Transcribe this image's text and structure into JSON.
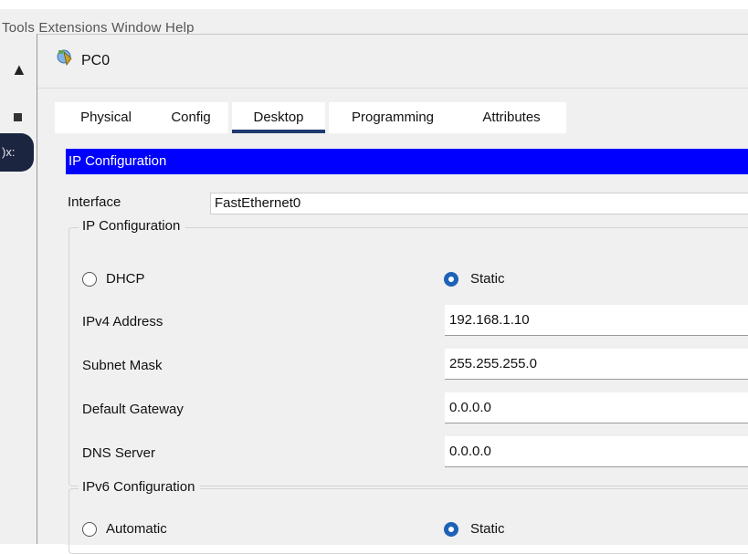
{
  "background_app": {
    "menu_text": "Tools Extensions Window Help",
    "side_text": ")x:"
  },
  "window": {
    "title": "PC0",
    "icon": "pc-app-icon"
  },
  "tabs": [
    {
      "label": "Physical",
      "active": false
    },
    {
      "label": "Config",
      "active": false
    },
    {
      "label": "Desktop",
      "active": true
    },
    {
      "label": "Programming",
      "active": false
    },
    {
      "label": "Attributes",
      "active": false
    }
  ],
  "ip_config": {
    "header": "IP Configuration",
    "interface_label": "Interface",
    "interface_value": "FastEthernet0",
    "ipv4": {
      "legend": "IP Configuration",
      "dhcp_label": "DHCP",
      "static_label": "Static",
      "mode": "Static",
      "fields": [
        {
          "label": "IPv4 Address",
          "value": "192.168.1.10"
        },
        {
          "label": "Subnet Mask",
          "value": "255.255.255.0"
        },
        {
          "label": "Default Gateway",
          "value": "0.0.0.0"
        },
        {
          "label": "DNS Server",
          "value": "0.0.0.0"
        }
      ]
    },
    "ipv6": {
      "legend": "IPv6 Configuration",
      "automatic_label": "Automatic",
      "static_label": "Static",
      "mode": "Static"
    }
  },
  "colors": {
    "header_bg": "#0000ff",
    "active_tab_underline": "#1f3b70",
    "radio_selected": "#1d62b8"
  }
}
